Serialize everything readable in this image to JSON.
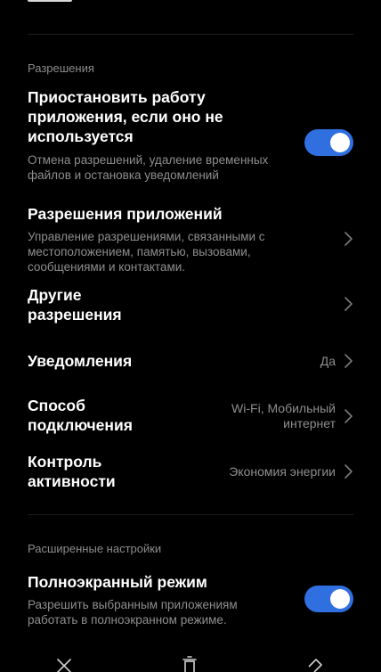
{
  "permissions_section": {
    "header": "Разрешения",
    "pause_app": {
      "title": "Приостановить работу приложения, если оно не используется",
      "description": "Отмена разрешений, удаление временных файлов и остановка уведомлений",
      "enabled": true
    },
    "app_permissions": {
      "title": "Разрешения приложений",
      "description": "Управление разрешениями, связанными с местоположением, памятью, вызовами, сообщениями и контактами."
    },
    "other_permissions": {
      "title": "Другие разрешения"
    },
    "notifications": {
      "title": "Уведомления",
      "value": "Да"
    },
    "connection": {
      "title": "Способ подключения",
      "value": "Wi-Fi, Мобильный интернет"
    },
    "activity_control": {
      "title": "Контроль активности",
      "value": "Экономия энергии"
    }
  },
  "advanced_section": {
    "header": "Расширенные настройки",
    "fullscreen": {
      "title": "Полноэкранный режим",
      "description": "Разрешить выбранным приложениям работать в полноэкранном режиме.",
      "enabled": true
    }
  },
  "colors": {
    "toggle_on": "#2f6fdf",
    "background": "#000000",
    "secondary_text": "#8e8e8e"
  },
  "icons": {
    "chevron": "chevron-right-icon",
    "bottom_left": "close-icon",
    "bottom_center": "trash-icon",
    "bottom_right": "eraser-icon"
  }
}
